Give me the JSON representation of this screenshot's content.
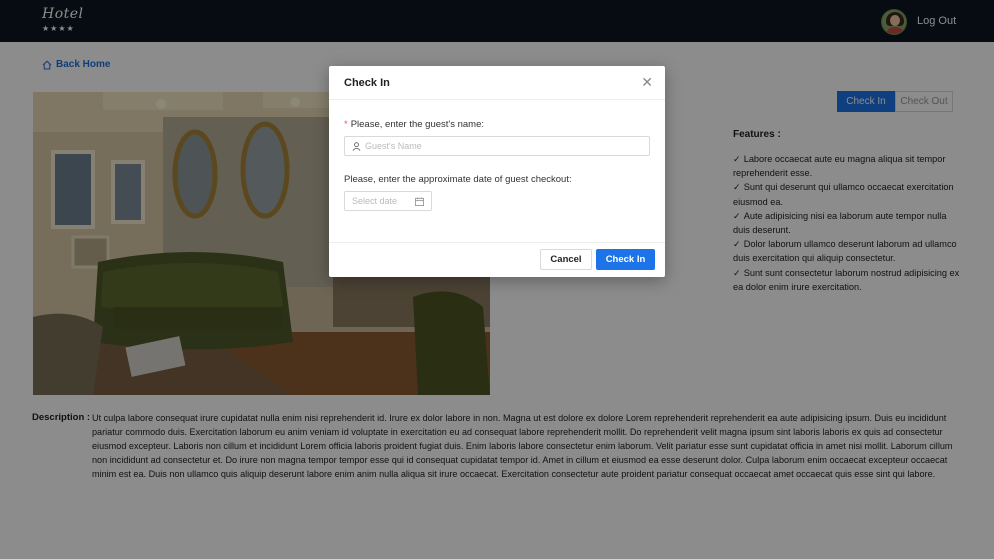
{
  "header": {
    "logo_text": "Hotel",
    "logo_stars": "★★★★",
    "logout_label": "Log Out"
  },
  "nav": {
    "back_home_label": "Back Home"
  },
  "segmented": {
    "checkin_label": "Check In",
    "checkout_label": "Check Out",
    "active": "Check In"
  },
  "features": {
    "title": "Features :",
    "items": [
      "Labore occaecat aute eu magna aliqua sit tempor reprehenderit esse.",
      "Sunt qui deserunt qui ullamco occaecat exercitation eiusmod ea.",
      "Aute adipisicing nisi ea laborum aute tempor nulla duis deserunt.",
      "Dolor laborum ullamco deserunt laborum ad ullamco duis exercitation qui aliquip consectetur.",
      "Sunt sunt consectetur laborum nostrud adipisicing ex ea dolor enim irure exercitation."
    ]
  },
  "description": {
    "label": "Description :",
    "text": "Ut culpa labore consequat irure cupidatat nulla enim nisi reprehenderit id. Irure ex dolor labore in non. Magna ut est dolore ex dolore Lorem reprehenderit reprehenderit ea aute adipisicing ipsum. Duis eu incididunt pariatur commodo duis. Exercitation laborum eu anim veniam id voluptate in exercitation eu ad consequat labore reprehenderit mollit. Do reprehenderit velit magna ipsum sint laboris laboris ex quis ad consectetur eiusmod excepteur. Laboris non cillum et incididunt Lorem officia laboris proident fugiat duis. Enim laboris labore consectetur enim laborum. Velit pariatur esse sunt cupidatat officia in amet nisi mollit. Laborum cillum non incididunt ad consectetur et. Do irure non magna tempor tempor esse qui id consequat cupidatat tempor id. Amet in cillum et eiusmod ea esse deserunt dolor. Culpa laborum enim occaecat excepteur occaecat minim est ea. Duis non ullamco quis aliquip deserunt labore enim anim nulla aliqua sit irure occaecat. Exercitation consectetur aute proident pariatur consequat occaecat amet occaecat quis esse sint qui labore."
  },
  "modal": {
    "title": "Check In",
    "close_icon": "close-icon",
    "name_label": "Please, enter the guest's name:",
    "name_required_mark": "*",
    "name_placeholder": "Guest's Name",
    "name_value": "",
    "date_label": "Please, enter the approximate date of guest checkout:",
    "date_placeholder": "Select date",
    "cancel_label": "Cancel",
    "submit_label": "Check In"
  },
  "colors": {
    "header_bg": "#0d1421",
    "primary": "#1d73e8",
    "required": "#ff4d4f",
    "overlay": "rgba(0,0,0,0.45)"
  }
}
